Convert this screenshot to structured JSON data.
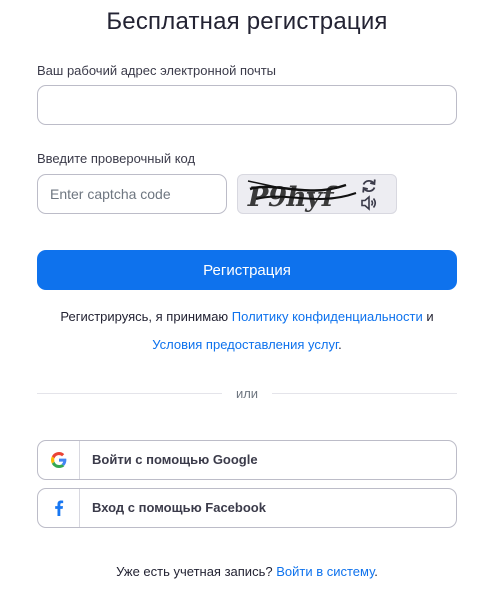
{
  "title": "Бесплатная регистрация",
  "email": {
    "label": "Ваш рабочий адрес электронной почты",
    "value": "",
    "placeholder": ""
  },
  "captcha": {
    "label": "Введите проверочный код",
    "placeholder": "Enter captcha code",
    "image_text": "P9hyf",
    "refresh_icon": "refresh-icon",
    "audio_icon": "speaker-icon"
  },
  "register_button": "Регистрация",
  "terms": {
    "prefix": "Регистрируясь, я принимаю ",
    "privacy_link": "Политику конфиденциальности",
    "conjunction": " и",
    "tos_link": "Условия предоставления услуг",
    "suffix": "."
  },
  "divider_text": "или",
  "sso": {
    "google_label": "Войти с помощью Google",
    "google_icon": "google-icon",
    "facebook_label": "Вход с помощью Facebook",
    "facebook_icon": "facebook-icon"
  },
  "signin": {
    "prefix": "Уже есть учетная запись? ",
    "link": "Войти в систему",
    "suffix": "."
  },
  "colors": {
    "accent": "#0e72ed",
    "text": "#232333",
    "border": "#bcbcc8"
  }
}
